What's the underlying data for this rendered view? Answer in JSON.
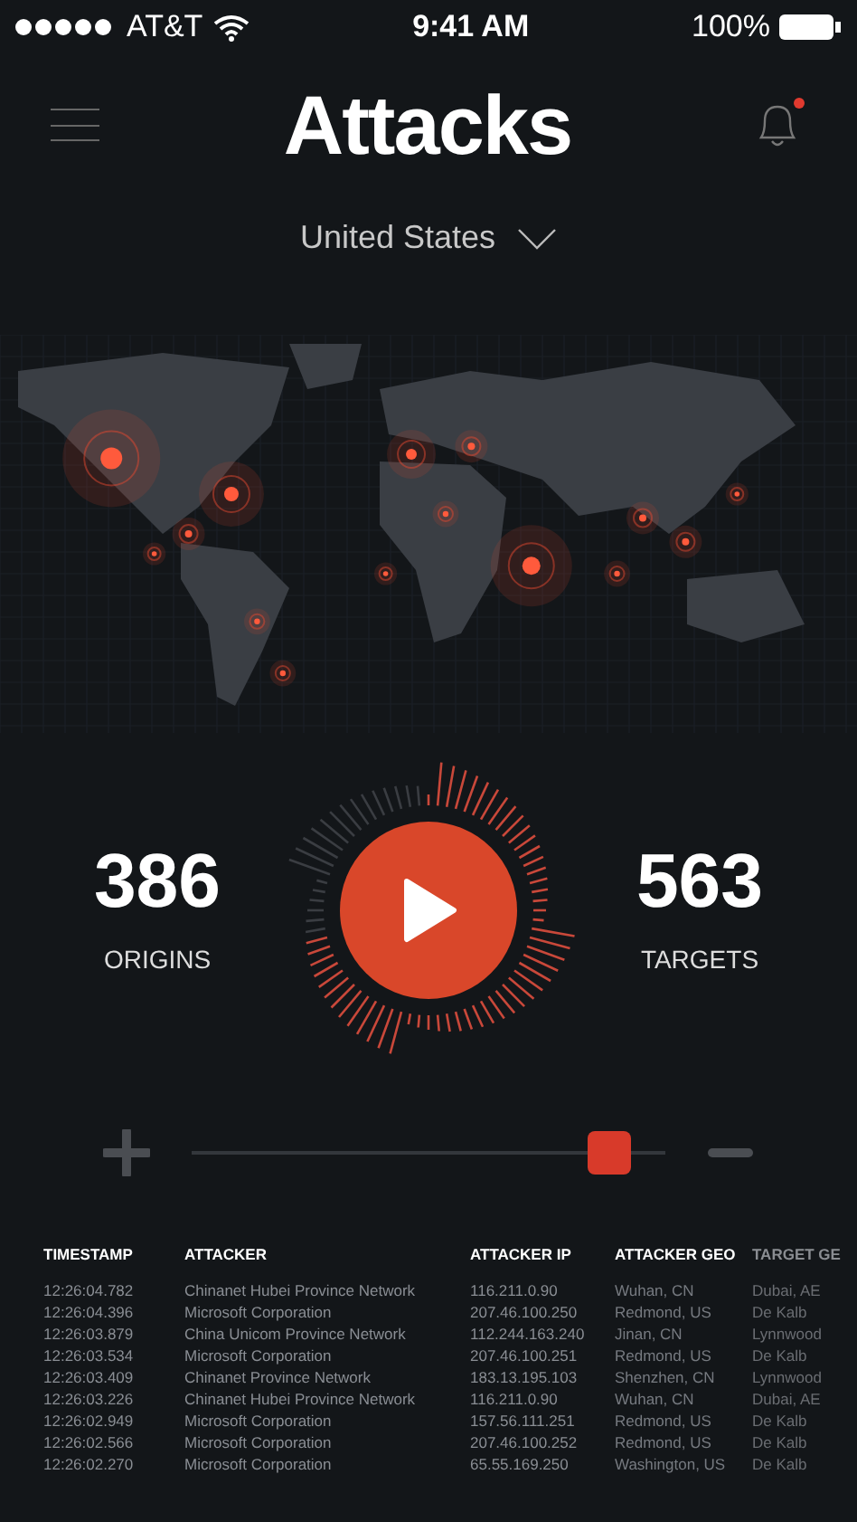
{
  "status_bar": {
    "carrier": "AT&T",
    "time": "9:41 AM",
    "battery": "100%"
  },
  "header": {
    "title": "Attacks",
    "notification": true
  },
  "country": {
    "value": "United States"
  },
  "stats": [
    {
      "value": "386",
      "label": "ORIGINS"
    },
    {
      "value": "563",
      "label": "TARGETS"
    }
  ],
  "speed": {
    "level": 0.88
  },
  "table": {
    "columns": [
      "TIMESTAMP",
      "ATTACKER",
      "ATTACKER IP",
      "ATTACKER GEO",
      "TARGET GE"
    ],
    "rows": [
      [
        "12:26:04.782",
        "Chinanet Hubei Province Network",
        "116.211.0.90",
        "Wuhan, CN",
        "Dubai, AE"
      ],
      [
        "12:26:04.396",
        "Microsoft Corporation",
        "207.46.100.250",
        "Redmond, US",
        "De Kalb"
      ],
      [
        "12:26:03.879",
        "China Unicom  Province Network",
        "112.244.163.240",
        "Jinan, CN",
        "Lynnwood"
      ],
      [
        "12:26:03.534",
        "Microsoft Corporation",
        "207.46.100.251",
        "Redmond, US",
        "De Kalb"
      ],
      [
        "12:26:03.409",
        "Chinanet Province Network",
        "183.13.195.103",
        "Shenzhen, CN",
        "Lynnwood"
      ],
      [
        "12:26:03.226",
        "Chinanet Hubei Province Network",
        "116.211.0.90",
        "Wuhan, CN",
        "Dubai, AE"
      ],
      [
        "12:26:02.949",
        "Microsoft Corporation",
        "157.56.111.251",
        "Redmond, US",
        "De Kalb"
      ],
      [
        "12:26:02.566",
        "Microsoft Corporation",
        "207.46.100.252",
        "Redmond, US",
        "De Kalb"
      ],
      [
        "12:26:02.270",
        "Microsoft Corporation",
        "65.55.169.250",
        "Washington, US",
        "De Kalb"
      ]
    ]
  }
}
